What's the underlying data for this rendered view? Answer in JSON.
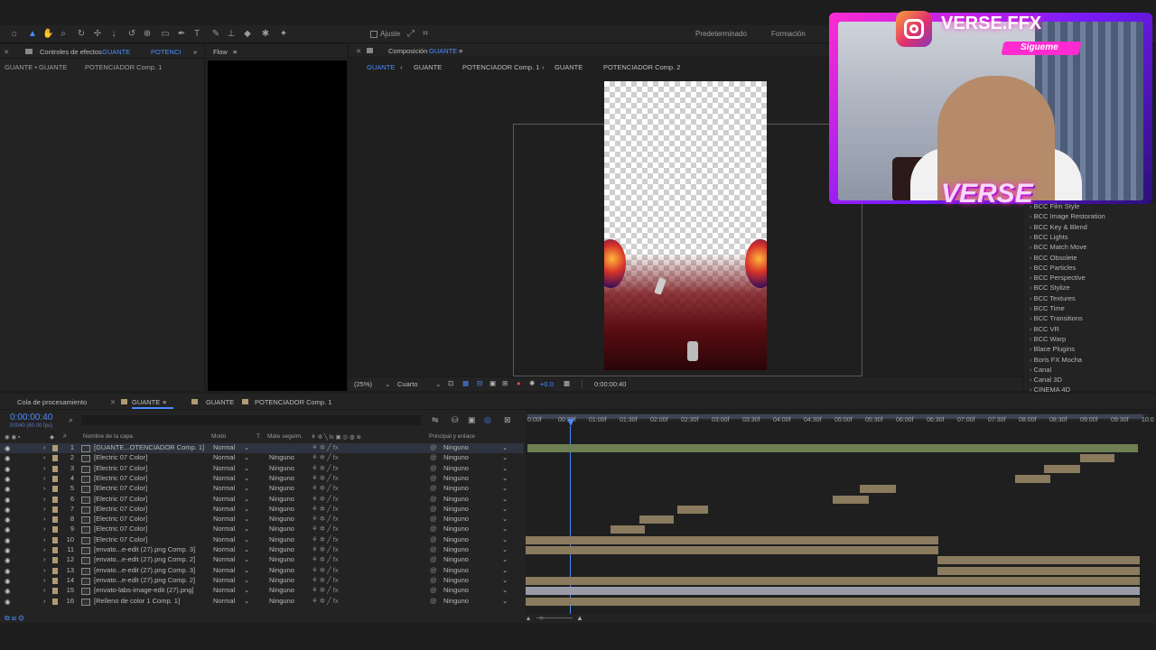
{
  "toolbar": {
    "ajuste": "Ajuste",
    "ws1": "Predeterminado",
    "ws2": "Formación"
  },
  "left_panel": {
    "tab_prefix": "Controles de efectos",
    "tab_comp": "GUANTE",
    "tab_extra": "POTENCI",
    "breadcrumb_a": "GUANTE • GUANTE",
    "breadcrumb_b": "POTENCIADOR Comp. 1"
  },
  "flow_panel": {
    "tab": "Flow"
  },
  "composition": {
    "tab_prefix": "Composición",
    "tab_comp": "GUANTE",
    "nav": [
      "GUANTE",
      "GUANTE",
      "POTENCIADOR Comp. 1",
      "GUANTE",
      "POTENCIADOR Comp. 2"
    ],
    "zoom": "(25%)",
    "resolution": "Cuarto",
    "plus": "+0.0",
    "time": "0:00:00:40"
  },
  "effects": [
    "BCC Film Style",
    "BCC Image Restoration",
    "BCC Key & Blend",
    "BCC Lights",
    "BCC Match Move",
    "BCC Obsolete",
    "BCC Particles",
    "BCC Perspective",
    "BCC Stylize",
    "BCC Textures",
    "BCC Time",
    "BCC Transitions",
    "BCC VR",
    "BCC Warp",
    "Blace Plugins",
    "Boris FX Mocha",
    "Canal",
    "Canal 3D",
    "CINEMA 4D"
  ],
  "webcam": {
    "handle": "VERSE.FFX",
    "cta": "Sigueme",
    "logo": "VERSE"
  },
  "timeline_tabs": {
    "queue": "Cola de procesamiento",
    "t1": "GUANTE",
    "t2": "GUANTE",
    "t3": "POTENCIADOR Comp. 1"
  },
  "timeline": {
    "timecode": "0:00:00:40",
    "fps": "00040 (60.00 fps)",
    "headers": {
      "name": "Nombre de la capa",
      "mode": "Modo",
      "t": "T",
      "mate": "Mate seguim.",
      "parent": "Principal y enlace"
    },
    "ticks": [
      "0:00f",
      "00:30f",
      "01:00f",
      "01:30f",
      "02:00f",
      "02:30f",
      "03:00f",
      "03:30f",
      "04:00f",
      "04:30f",
      "05:00f",
      "05:30f",
      "06:00f",
      "06:30f",
      "07:00f",
      "07:30f",
      "08:00f",
      "08:30f",
      "09:00f",
      "09:30f",
      "10:0"
    ],
    "layers": [
      {
        "n": "1",
        "name": "[GUANTE...OTENCIADOR Comp. 1]",
        "mode": "Normal",
        "mate": "",
        "parent": "Ninguno"
      },
      {
        "n": "2",
        "name": "[Electric 07 Color]",
        "mode": "Normal",
        "mate": "Ninguno",
        "parent": "Ninguno"
      },
      {
        "n": "3",
        "name": "[Electric 07 Color]",
        "mode": "Normal",
        "mate": "Ninguno",
        "parent": "Ninguno"
      },
      {
        "n": "4",
        "name": "[Electric 07 Color]",
        "mode": "Normal",
        "mate": "Ninguno",
        "parent": "Ninguno"
      },
      {
        "n": "5",
        "name": "[Electric 07 Color]",
        "mode": "Normal",
        "mate": "Ninguno",
        "parent": "Ninguno"
      },
      {
        "n": "6",
        "name": "[Electric 07 Color]",
        "mode": "Normal",
        "mate": "Ninguno",
        "parent": "Ninguno"
      },
      {
        "n": "7",
        "name": "[Electric 07 Color]",
        "mode": "Normal",
        "mate": "Ninguno",
        "parent": "Ninguno"
      },
      {
        "n": "8",
        "name": "[Electric 07 Color]",
        "mode": "Normal",
        "mate": "Ninguno",
        "parent": "Ninguno"
      },
      {
        "n": "9",
        "name": "[Electric 07 Color]",
        "mode": "Normal",
        "mate": "Ninguno",
        "parent": "Ninguno"
      },
      {
        "n": "10",
        "name": "[Electric 07 Color]",
        "mode": "Normal",
        "mate": "Ninguno",
        "parent": "Ninguno"
      },
      {
        "n": "11",
        "name": "[envato...e-edit (27).png Comp. 3]",
        "mode": "Normal",
        "mate": "Ninguno",
        "parent": "Ninguno"
      },
      {
        "n": "12",
        "name": "[envato...e-edit (27).png Comp. 2]",
        "mode": "Normal",
        "mate": "Ninguno",
        "parent": "Ninguno"
      },
      {
        "n": "13",
        "name": "[envato...e-edit (27).png Comp. 3]",
        "mode": "Normal",
        "mate": "Ninguno",
        "parent": "Ninguno"
      },
      {
        "n": "14",
        "name": "[envato...e-edit (27).png Comp. 2]",
        "mode": "Normal",
        "mate": "Ninguno",
        "parent": "Ninguno"
      },
      {
        "n": "15",
        "name": "[envato-labs-image-edit (27).png]",
        "mode": "Normal",
        "mate": "Ninguno",
        "parent": "Ninguno"
      },
      {
        "n": "16",
        "name": "[Relleno de color 1 Comp. 1]",
        "mode": "Normal",
        "mate": "Ninguno",
        "parent": "Ninguno"
      }
    ]
  },
  "colors": {
    "accent": "#4b8cff",
    "clip": "#8a7a5e",
    "clip_top": "#7a8a5a",
    "solid": "#9a9aa8"
  }
}
